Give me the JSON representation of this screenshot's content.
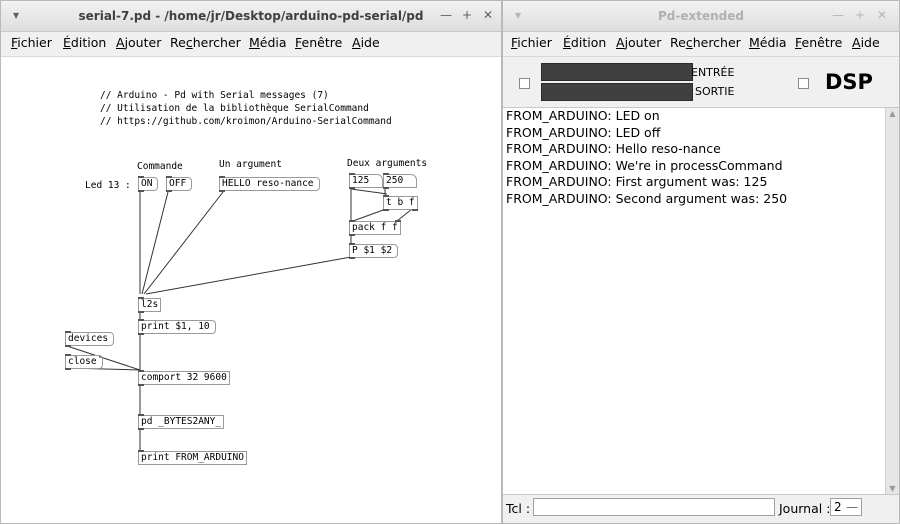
{
  "left_window": {
    "title": "serial-7.pd  - /home/jr/Desktop/arduino-pd-serial/pd",
    "controls": {
      "menu": "▾",
      "minimize": "—",
      "maximize": "+",
      "close": "✕"
    },
    "menu": [
      {
        "mn": "F",
        "rest": "ichier"
      },
      {
        "mn": "É",
        "rest": "dition"
      },
      {
        "mn": "A",
        "rest": "jouter"
      },
      {
        "pre": "Re",
        "mn": "c",
        "rest": "hercher"
      },
      {
        "mn": "M",
        "rest": "édia"
      },
      {
        "mn": "F",
        "rest": "enêtre"
      },
      {
        "mn": "A",
        "rest": "ide"
      }
    ],
    "patch": {
      "comments": [
        "// Arduino - Pd with Serial messages (7)",
        "// Utilisation de la bibliothèque SerialCommand",
        "// https://github.com/kroimon/Arduino-SerialCommand"
      ],
      "label_commande": "Commande",
      "label_un_argument": "Un argument",
      "label_deux_arguments": "Deux arguments",
      "label_led13": "Led 13 :",
      "msg_on": "ON",
      "msg_off": "OFF",
      "msg_hello": "HELLO reso-nance",
      "num_125": "125",
      "num_250": "250",
      "obj_tbf": "t b f",
      "obj_pack": "pack f f",
      "msg_p": "P $1 $2",
      "obj_l2s": "l2s",
      "msg_print": "print $1, 10",
      "msg_devices": "devices",
      "msg_close": "close",
      "obj_comport": "comport 32 9600",
      "obj_bytes2any": "pd _BYTES2ANY_",
      "obj_print_arduino": "print FROM_ARDUINO"
    }
  },
  "right_window": {
    "title": "Pd-extended",
    "controls": {
      "menu": "▾",
      "minimize": "—",
      "maximize": "+",
      "close": "✕"
    },
    "menu": [
      {
        "mn": "F",
        "rest": "ichier"
      },
      {
        "mn": "É",
        "rest": "dition"
      },
      {
        "mn": "A",
        "rest": "jouter"
      },
      {
        "pre": "Re",
        "mn": "c",
        "rest": "hercher"
      },
      {
        "mn": "M",
        "rest": "édia"
      },
      {
        "mn": "F",
        "rest": "enêtre"
      },
      {
        "mn": "A",
        "rest": "ide"
      }
    ],
    "entree_label": "ENTRÉE",
    "sortie_label": "SORTIE",
    "dsp_label": "DSP",
    "console_lines": [
      "FROM_ARDUINO: LED on",
      "FROM_ARDUINO: LED off",
      "FROM_ARDUINO: Hello reso-nance",
      "FROM_ARDUINO: We're in processCommand",
      "FROM_ARDUINO: First argument was: 125",
      "FROM_ARDUINO: Second argument was: 250"
    ],
    "tcl_label": "Tcl :",
    "tcl_value": "",
    "journal_label": "Journal :",
    "journal_value": "2",
    "scroll_up": "▲",
    "scroll_down": "▼"
  }
}
